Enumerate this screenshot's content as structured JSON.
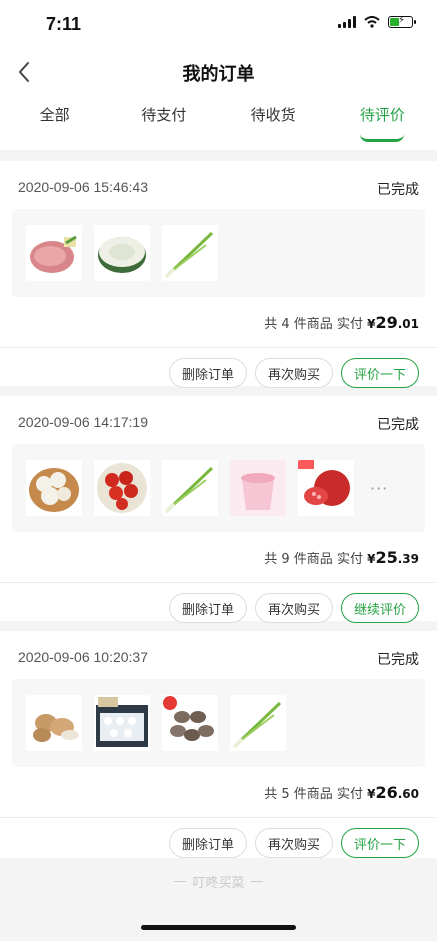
{
  "status_bar": {
    "time": "7:11"
  },
  "nav": {
    "title": "我的订单"
  },
  "tabs": [
    {
      "label": "全部",
      "active": false
    },
    {
      "label": "待支付",
      "active": false
    },
    {
      "label": "待收货",
      "active": false
    },
    {
      "label": "待评价",
      "active": true
    }
  ],
  "orders": [
    {
      "timestamp": "2020-09-06 15:46:43",
      "status": "已完成",
      "items": [
        "meat-product",
        "winter-melon-product",
        "green-onion-product"
      ],
      "count_text": "共 4 件商品",
      "paid_label": "实付",
      "currency": "¥",
      "amount_int": "29",
      "amount_dec": ".01",
      "actions": {
        "delete": "删除订单",
        "rebuy": "再次购买",
        "review": "评价一下"
      }
    },
    {
      "timestamp": "2020-09-06 14:17:19",
      "status": "已完成",
      "items": [
        "mushroom-product",
        "cherry-tomato-product",
        "green-onion-product",
        "ice-cream-product",
        "pomegranate-product"
      ],
      "more": "···",
      "count_text": "共 9 件商品",
      "paid_label": "实付",
      "currency": "¥",
      "amount_int": "25",
      "amount_dec": ".39",
      "actions": {
        "delete": "删除订单",
        "rebuy": "再次购买",
        "review": "继续评价"
      }
    },
    {
      "timestamp": "2020-09-06 10:20:37",
      "status": "已完成",
      "items": [
        "potato-product",
        "dumpling-product",
        "abalone-product",
        "green-onion-product"
      ],
      "count_text": "共 5 件商品",
      "paid_label": "实付",
      "currency": "¥",
      "amount_int": "26",
      "amount_dec": ".60",
      "actions": {
        "delete": "删除订单",
        "rebuy": "再次购买",
        "review": "评价一下"
      }
    }
  ],
  "footer": {
    "brand": "叮咚买菜"
  },
  "colors": {
    "accent": "#25a244",
    "background": "#f4f4f4"
  }
}
